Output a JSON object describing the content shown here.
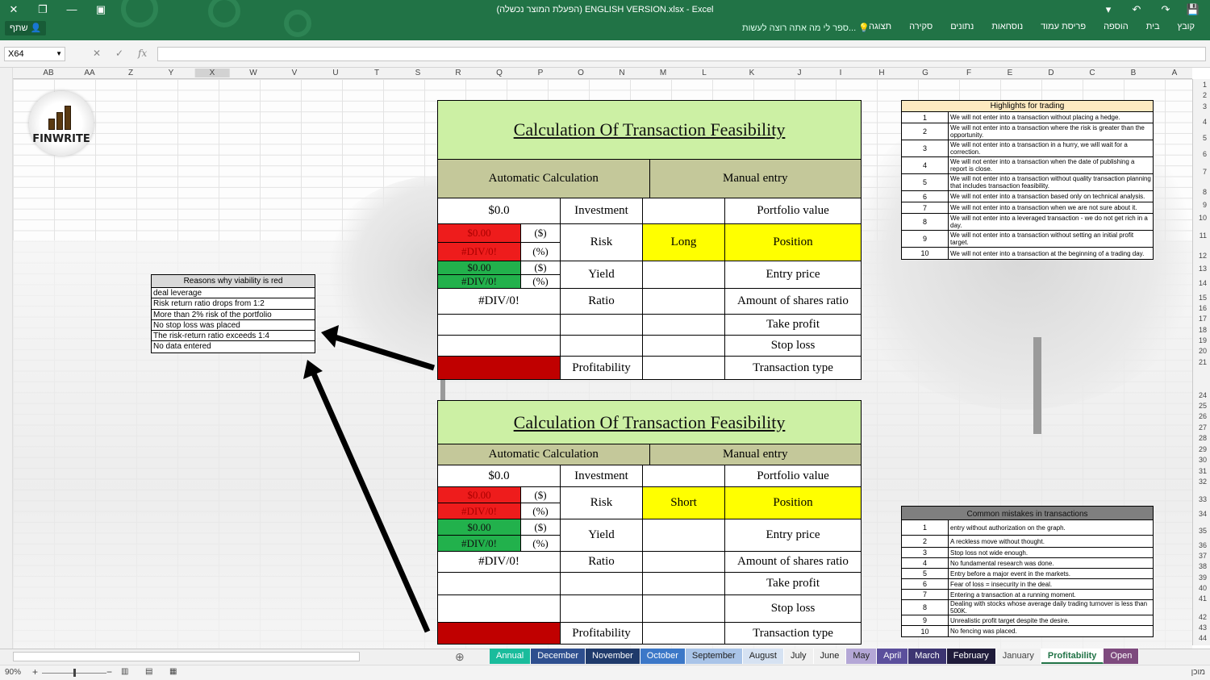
{
  "window": {
    "title": "(הפעלת המוצר נכשלה) ENGLISH VERSION.xlsx - Excel",
    "share_label": "שתף",
    "tell_me": "ספר לי מה אתה רוצה לעשות...",
    "tabs": [
      "קובץ",
      "בית",
      "הוספה",
      "פריסת עמוד",
      "נוסחאות",
      "נתונים",
      "סקירה",
      "תצוגה"
    ]
  },
  "formula_bar": {
    "name_box": "X64",
    "cancel": "✕",
    "enter": "✓",
    "fx": "fx",
    "value": ""
  },
  "columns": [
    "AB",
    "AA",
    "Z",
    "Y",
    "X",
    "W",
    "V",
    "U",
    "T",
    "S",
    "R",
    "Q",
    "P",
    "O",
    "N",
    "M",
    "L",
    "K",
    "J",
    "I",
    "H",
    "G",
    "F",
    "E",
    "D",
    "C",
    "B",
    "A"
  ],
  "rows": [
    "1",
    "2",
    "3",
    "4",
    "5",
    "6",
    "7",
    "8",
    "9",
    "10",
    "11",
    "12",
    "13",
    "14",
    "15",
    "16",
    "17",
    "18",
    "19",
    "20",
    "21",
    "24",
    "25",
    "26",
    "27",
    "28",
    "29",
    "30",
    "31",
    "32",
    "33",
    "34",
    "35",
    "36",
    "37",
    "38",
    "39",
    "40",
    "41",
    "42",
    "43",
    "44"
  ],
  "logo": {
    "text": "FINWRITE"
  },
  "reasons": {
    "header": "Reasons why viability is red",
    "items": [
      "deal leverage",
      "Risk return ratio drops from 1:2",
      "More than 2% risk of the portfolio",
      "No stop loss was placed",
      "The risk-return ratio exceeds 1:4",
      "No data entered"
    ]
  },
  "calc1": {
    "title": "Calculation Of Transaction Feasibility",
    "auto": "Automatic Calculation",
    "manual": "Manual entry",
    "investment_value": "$0.0",
    "investment": "Investment",
    "portfolio_value": "Portfolio value",
    "risk_dollar": "$0.00",
    "risk_pct": "#DIV/0!",
    "unit_dollar": "($)",
    "unit_pct": "(%)",
    "risk": "Risk",
    "position_value": "Long",
    "position": "Position",
    "yield_dollar": "$0.00",
    "yield_pct": "#DIV/0!",
    "yield": "Yield",
    "entry_price": "Entry price",
    "ratio_value": "#DIV/0!",
    "ratio": "Ratio",
    "shares_ratio": "Amount of shares ratio",
    "take_profit": "Take profit",
    "stop_loss": "Stop loss",
    "profitability": "Profitability",
    "transaction_type": "Transaction type"
  },
  "calc2": {
    "title": "Calculation Of Transaction Feasibility",
    "auto": "Automatic Calculation",
    "manual": "Manual entry",
    "investment_value": "$0.0",
    "investment": "Investment",
    "portfolio_value": "Portfolio value",
    "risk_dollar": "$0.00",
    "risk_pct": "#DIV/0!",
    "unit_dollar": "($)",
    "unit_pct": "(%)",
    "risk": "Risk",
    "position_value": "Short",
    "position": "Position",
    "yield_dollar": "$0.00",
    "yield_pct": "#DIV/0!",
    "yield": "Yield",
    "entry_price": "Entry price",
    "ratio_value": "#DIV/0!",
    "ratio": "Ratio",
    "shares_ratio": "Amount of shares ratio",
    "take_profit": "Take profit",
    "stop_loss": "Stop loss",
    "profitability": "Profitability",
    "transaction_type": "Transaction type"
  },
  "highlights": {
    "header": "Highlights for trading",
    "items": [
      {
        "n": "1",
        "t": "We will not enter into a transaction without placing a hedge."
      },
      {
        "n": "2",
        "t": "We will not enter into a transaction where the risk is greater than the opportunity."
      },
      {
        "n": "3",
        "t": "We will not enter into a transaction in a hurry, we will wait for a correction."
      },
      {
        "n": "4",
        "t": "We will not enter into a transaction when the date of publishing a report is close."
      },
      {
        "n": "5",
        "t": "We will not enter into a transaction without quality transaction planning that includes transaction feasibility."
      },
      {
        "n": "6",
        "t": "We will not enter into a transaction based only on technical analysis."
      },
      {
        "n": "7",
        "t": "We will not enter into a transaction when we are not sure about it."
      },
      {
        "n": "8",
        "t": "We will not enter into a leveraged transaction - we do not get rich in a day."
      },
      {
        "n": "9",
        "t": "We will not enter into a transaction without setting an initial profit target."
      },
      {
        "n": "10",
        "t": "We will not enter into a transaction at the beginning of a trading day."
      }
    ]
  },
  "mistakes": {
    "header": "Common mistakes in transactions",
    "items": [
      {
        "n": "1",
        "t": "entry without authorization on the graph."
      },
      {
        "n": "2",
        "t": "A reckless move without thought."
      },
      {
        "n": "3",
        "t": "Stop loss not wide enough."
      },
      {
        "n": "4",
        "t": "No fundamental research was done."
      },
      {
        "n": "5",
        "t": "Entry before a major event in the markets."
      },
      {
        "n": "6",
        "t": "Fear of loss = insecurity in the deal."
      },
      {
        "n": "7",
        "t": "Entering a transaction at a running moment."
      },
      {
        "n": "8",
        "t": "Dealing with stocks whose average daily trading turnover is less than 500K."
      },
      {
        "n": "9",
        "t": "Unrealistic profit target despite the desire."
      },
      {
        "n": "10",
        "t": "No fencing was placed."
      }
    ]
  },
  "sheets": [
    {
      "name": "Annual",
      "bg": "#1abc9c",
      "fg": "#ffffff"
    },
    {
      "name": "December",
      "bg": "#2e4f8f",
      "fg": "#ffffff"
    },
    {
      "name": "November",
      "bg": "#1f3a6b",
      "fg": "#ffffff"
    },
    {
      "name": "October",
      "bg": "#3c78c8",
      "fg": "#ffffff"
    },
    {
      "name": "September",
      "bg": "#a9c4e8",
      "fg": "#222222"
    },
    {
      "name": "August",
      "bg": "#d6e2f2",
      "fg": "#222222"
    },
    {
      "name": "July",
      "bg": "#f0f0f0",
      "fg": "#222222"
    },
    {
      "name": "June",
      "bg": "#f0f0f0",
      "fg": "#222222"
    },
    {
      "name": "May",
      "bg": "#b4a7d6",
      "fg": "#222222"
    },
    {
      "name": "April",
      "bg": "#5b4f9c",
      "fg": "#ffffff"
    },
    {
      "name": "March",
      "bg": "#3d3572",
      "fg": "#ffffff"
    },
    {
      "name": "February",
      "bg": "#1f1b3a",
      "fg": "#ffffff"
    },
    {
      "name": "January",
      "bg": "#f0f0f0",
      "fg": "#444444"
    },
    {
      "name": "Profitability",
      "bg": "#ffffff",
      "fg": "#217346"
    },
    {
      "name": "Open",
      "bg": "#7e4a7e",
      "fg": "#ffffff"
    }
  ],
  "status": {
    "zoom": "90%",
    "ready": "מוכן"
  }
}
